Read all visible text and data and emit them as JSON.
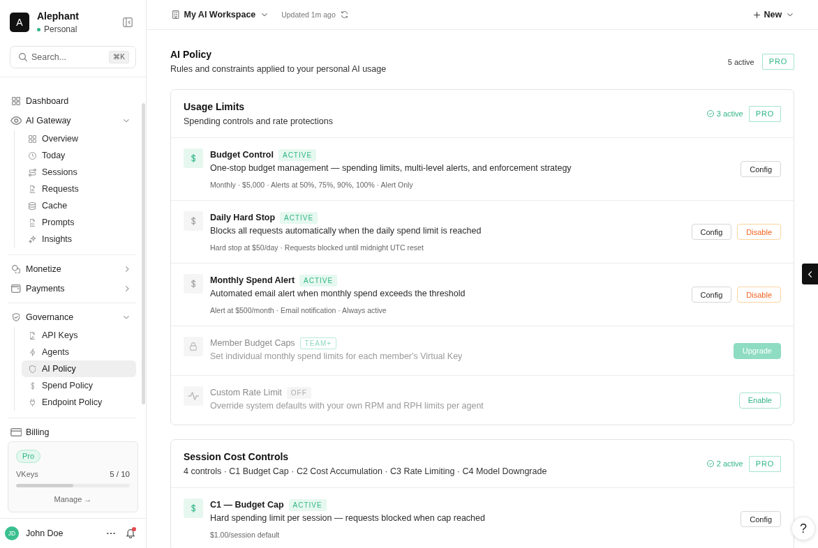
{
  "sidebar": {
    "brand": {
      "logo": "A",
      "name": "Alephant",
      "workspace": "Personal"
    },
    "search": {
      "placeholder": "Search...",
      "shortcut": "⌘K"
    },
    "nav_sections": [
      {
        "items": [
          {
            "kind": "link",
            "label": "Dashboard",
            "selected": false
          },
          {
            "kind": "group",
            "label": "AI Gateway",
            "selected": false,
            "expanded": true,
            "children": [
              {
                "label": "Overview",
                "selected": false
              },
              {
                "label": "Today",
                "selected": false
              },
              {
                "label": "Sessions",
                "selected": false
              },
              {
                "label": "Requests",
                "selected": false
              },
              {
                "label": "Cache",
                "selected": false
              },
              {
                "label": "Prompts",
                "selected": false
              },
              {
                "label": "Insights",
                "selected": false
              }
            ]
          }
        ]
      },
      {
        "items": [
          {
            "kind": "group",
            "label": "Monetize",
            "selected": false,
            "expanded": false
          },
          {
            "kind": "group",
            "label": "Payments",
            "selected": false,
            "expanded": false
          }
        ]
      },
      {
        "items": [
          {
            "kind": "group",
            "label": "Governance",
            "selected": false,
            "expanded": true,
            "children": [
              {
                "label": "API Keys",
                "selected": false
              },
              {
                "label": "Agents",
                "selected": false
              },
              {
                "label": "AI Policy",
                "selected": true
              },
              {
                "label": "Spend Policy",
                "selected": false
              },
              {
                "label": "Endpoint Policy",
                "selected": false
              }
            ]
          }
        ]
      },
      {
        "items": [
          {
            "kind": "link",
            "label": "Billing",
            "selected": false
          }
        ]
      }
    ],
    "plan": {
      "badge": "Pro",
      "label": "VKeys",
      "count": "5 / 10",
      "level": 0.5,
      "link": "Manage →"
    },
    "user": {
      "initials": "JD",
      "name": "John Doe",
      "notification": true
    }
  },
  "topbar": {
    "workspace": "My AI Workspace",
    "updated": "Updated 1m ago",
    "new_button": "New"
  },
  "page": {
    "title": "AI Policy",
    "subtitle": "Rules and constraints applied to your personal AI usage",
    "active_count": "5 active",
    "tier": "PRO"
  },
  "sections": [
    {
      "title": "Usage Limits",
      "subtitle": "Spending controls and rate protections",
      "active_count": "3 active",
      "tier": "PRO",
      "policies": [
        {
          "name": "Budget Control",
          "badge": {
            "text": "ACTIVE",
            "kind": "active"
          },
          "description": "One-stop budget management — spending limits, multi-level alerts, and enforcement strategy",
          "details": "Monthly · $5,000 · Alerts at 50%, 75%, 90%, 100% · Alert Only",
          "highlighted": true,
          "disabled": false,
          "actions": [
            {
              "label": "Config",
              "kind": "outline"
            }
          ]
        },
        {
          "name": "Daily Hard Stop",
          "badge": {
            "text": "ACTIVE",
            "kind": "active"
          },
          "description": "Blocks all requests automatically when the daily spend limit is reached",
          "details": "Hard stop at $50/day · Requests blocked until midnight UTC reset",
          "highlighted": false,
          "disabled": false,
          "actions": [
            {
              "label": "Config",
              "kind": "outline"
            },
            {
              "label": "Disable",
              "kind": "danger"
            }
          ]
        },
        {
          "name": "Monthly Spend Alert",
          "badge": {
            "text": "ACTIVE",
            "kind": "active"
          },
          "description": "Automated email alert when monthly spend exceeds the threshold",
          "details": "Alert at $500/month · Email notification · Always active",
          "highlighted": false,
          "disabled": false,
          "actions": [
            {
              "label": "Config",
              "kind": "outline"
            },
            {
              "label": "Disable",
              "kind": "danger"
            }
          ]
        },
        {
          "name": "Member Budget Caps",
          "badge": {
            "text": "TEAM+",
            "kind": "tier"
          },
          "description": "Set individual monthly spend limits for each member's Virtual Key",
          "highlighted": false,
          "disabled": true,
          "actions": [
            {
              "label": "Upgrade",
              "kind": "primary"
            }
          ]
        },
        {
          "name": "Custom Rate Limit",
          "badge": {
            "text": "OFF",
            "kind": "off"
          },
          "description": "Override system defaults with your own RPM and RPH limits per agent",
          "highlighted": false,
          "disabled": true,
          "actions": [
            {
              "label": "Enable",
              "kind": "accent"
            }
          ]
        }
      ]
    },
    {
      "title": "Session Cost Controls",
      "subtitle": "4 controls · C1 Budget Cap · C2 Cost Accumulation · C3 Rate Limiting · C4 Model Downgrade",
      "active_count": "2 active",
      "tier": "PRO",
      "policies": [
        {
          "name": "C1 — Budget Cap",
          "badge": {
            "text": "ACTIVE",
            "kind": "active"
          },
          "description": "Hard spending limit per session — requests blocked when cap reached",
          "details": "$1.00/session default",
          "highlighted": true,
          "disabled": false,
          "actions": [
            {
              "label": "Config",
              "kind": "outline"
            }
          ]
        }
      ]
    }
  ],
  "help": "?"
}
